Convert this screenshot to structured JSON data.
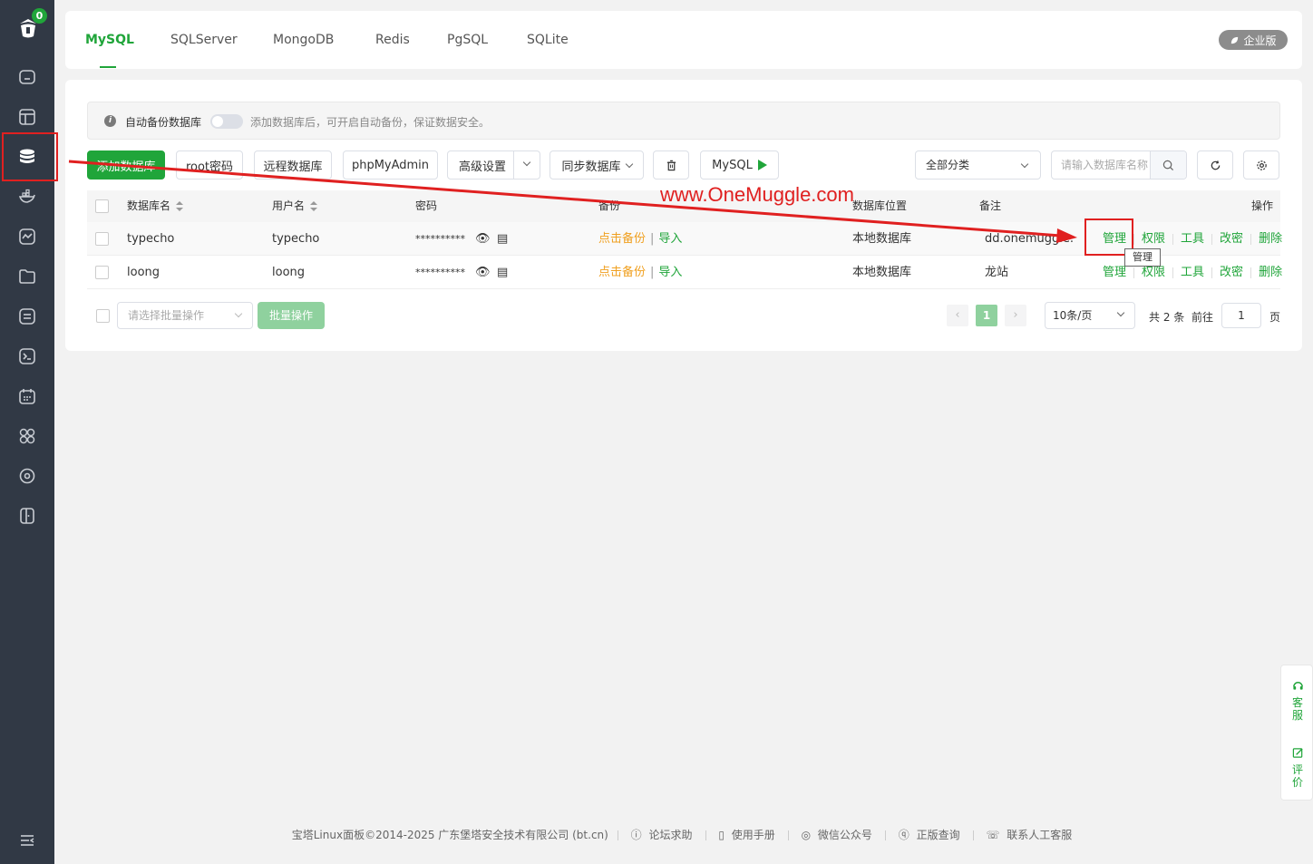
{
  "sidebar": {
    "badge_count": "0",
    "icons": [
      "home-icon",
      "website-icon",
      "database-icon",
      "docker-icon",
      "monitor-icon",
      "files-icon",
      "logs-icon",
      "terminal-icon",
      "cron-icon",
      "apps-icon",
      "settings-icon",
      "logout-icon"
    ],
    "collapse_icon": "menu-collapse-icon"
  },
  "tabs": [
    "MySQL",
    "SQLServer",
    "MongoDB",
    "Redis",
    "PgSQL",
    "SQLite"
  ],
  "enterprise_label": "企业版",
  "notice": {
    "label": "自动备份数据库",
    "hint": "添加数据库后，可开启自动备份，保证数据安全。"
  },
  "toolbar": {
    "add_db": "添加数据库",
    "root_pwd": "root密码",
    "remote_db": "远程数据库",
    "phpmyadmin": "phpMyAdmin",
    "advanced": "高级设置",
    "sync_db": "同步数据库",
    "mysql": "MySQL",
    "category": "全部分类",
    "search_placeholder": "请输入数据库名称"
  },
  "table": {
    "headers": {
      "name": "数据库名",
      "user": "用户名",
      "password": "密码",
      "backup": "备份",
      "location": "数据库位置",
      "remark": "备注",
      "ops": "操作"
    },
    "rows": [
      {
        "name": "typecho",
        "user": "typecho",
        "password": "**********",
        "backup": "点击备份",
        "import": "导入",
        "location": "本地数据库",
        "remark": "dd.onemuggle.com",
        "ops": [
          "管理",
          "权限",
          "工具",
          "改密",
          "删除"
        ]
      },
      {
        "name": "loong",
        "user": "loong",
        "password": "**********",
        "backup": "点击备份",
        "import": "导入",
        "location": "本地数据库",
        "remark": "龙站",
        "ops": [
          "管理",
          "权限",
          "工具",
          "改密",
          "删除"
        ]
      }
    ]
  },
  "batch": {
    "placeholder": "请选择批量操作",
    "button": "批量操作"
  },
  "pagination": {
    "current": "1",
    "page_size": "10条/页",
    "total": "共 2 条",
    "goto_label": "前往",
    "goto_value": "1",
    "page_suffix": "页"
  },
  "watermark": "www.OneMuggle.com",
  "tooltip": "管理",
  "float": {
    "service": "客服",
    "review": "评价"
  },
  "footer": {
    "copyright": "宝塔Linux面板©2014-2025 广东堡塔安全技术有限公司 (bt.cn)",
    "links": [
      "论坛求助",
      "使用手册",
      "微信公众号",
      "正版查询",
      "联系人工客服"
    ]
  },
  "colors": {
    "accent": "#20a53a",
    "sidebar": "#313945",
    "annotation": "#e02020"
  }
}
